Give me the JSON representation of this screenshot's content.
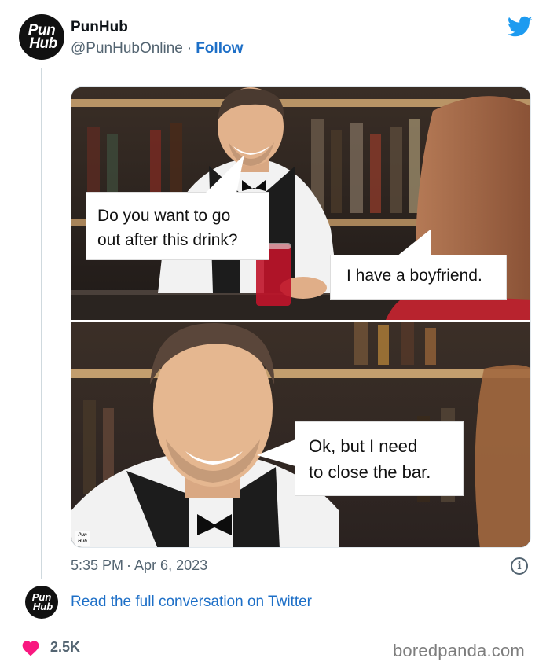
{
  "tweet": {
    "avatar_text": [
      "Pun",
      "Hub"
    ],
    "display_name": "PunHub",
    "handle": "@PunHubOnline",
    "separator": "·",
    "follow_label": "Follow",
    "timestamp_time": "5:35 PM",
    "timestamp_date": "Apr 6, 2023",
    "conversation_link": "Read the full conversation on Twitter",
    "likes": "2.5K"
  },
  "meme": {
    "bubble_1": [
      "Do you want to go",
      "out after this drink?"
    ],
    "bubble_2": "I have a boyfriend.",
    "bubble_3": [
      "Ok, but I need",
      "to close the bar."
    ],
    "watermark": [
      "Pun",
      "Hub"
    ]
  },
  "footer": {
    "brand": "boredpanda.com"
  },
  "colors": {
    "link_blue": "#1d6fc7",
    "twitter_blue": "#1d9bf0",
    "muted_gray": "#536471",
    "heart_pink": "#f91880"
  }
}
